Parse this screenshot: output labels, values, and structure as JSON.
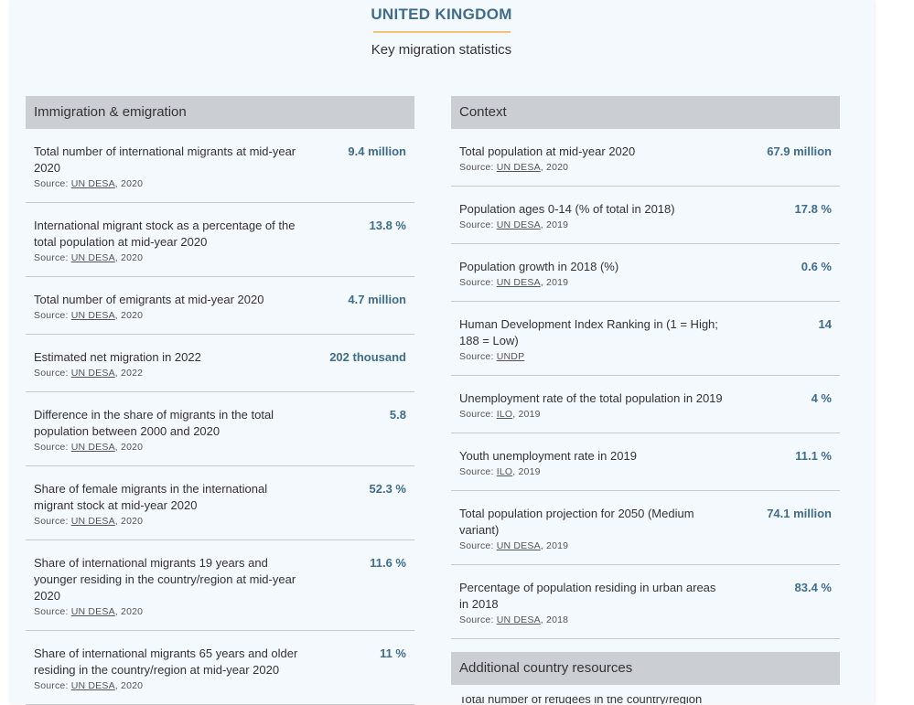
{
  "header": {
    "country": "UNITED KINGDOM",
    "subtitle": "Key migration statistics"
  },
  "immigration": {
    "title": "Immigration & emigration",
    "rows": [
      {
        "label": "Total number of international migrants at mid-year 2020",
        "value": "9.4 million",
        "source_prefix": "Source:",
        "source_link": "UN DESA",
        "source_year": ", 2020"
      },
      {
        "label": "International migrant stock as a percentage of the total population at mid-year 2020",
        "value": "13.8 %",
        "source_prefix": "Source:",
        "source_link": "UN DESA",
        "source_year": ", 2020"
      },
      {
        "label": "Total number of emigrants at mid-year 2020",
        "value": "4.7 million",
        "source_prefix": "Source:",
        "source_link": "UN DESA",
        "source_year": ", 2020"
      },
      {
        "label": "Estimated net migration in 2022",
        "value": "202 thousand",
        "source_prefix": "Source:",
        "source_link": "UN DESA",
        "source_year": ", 2022"
      },
      {
        "label": "Difference in the share of migrants in the total population between 2000 and 2020",
        "value": "5.8",
        "source_prefix": "Source:",
        "source_link": "UN DESA",
        "source_year": ", 2020"
      },
      {
        "label": "Share of female migrants in the international migrant stock at mid-year 2020",
        "value": "52.3 %",
        "source_prefix": "Source:",
        "source_link": "UN DESA",
        "source_year": ", 2020"
      },
      {
        "label": "Share of international migrants 19 years and younger residing in the country/region at mid-year 2020",
        "value": "11.6 %",
        "source_prefix": "Source:",
        "source_link": "UN DESA",
        "source_year": ", 2020"
      },
      {
        "label": "Share of international migrants 65 years and older residing in the country/region at mid-year 2020",
        "value": "11 %",
        "source_prefix": "Source:",
        "source_link": "UN DESA",
        "source_year": ", 2020"
      }
    ]
  },
  "context": {
    "title": "Context",
    "rows": [
      {
        "label": "Total population at mid-year 2020",
        "value": "67.9 million",
        "source_prefix": "Source:",
        "source_link": "UN DESA",
        "source_year": ", 2020"
      },
      {
        "label": "Population ages 0-14 (% of total in 2018)",
        "value": "17.8 %",
        "source_prefix": "Source:",
        "source_link": "UN DESA",
        "source_year": ", 2019"
      },
      {
        "label": "Population growth in 2018 (%)",
        "value": "0.6 %",
        "source_prefix": "Source:",
        "source_link": "UN DESA",
        "source_year": ", 2019"
      },
      {
        "label": "Human Development Index Ranking in (1 = High; 188 = Low)",
        "value": "14",
        "source_prefix": "Source:",
        "source_link": "UNDP",
        "source_year": ""
      },
      {
        "label": "Unemployment rate of the total population in 2019",
        "value": "4 %",
        "source_prefix": "Source:",
        "source_link": "ILO",
        "source_year": ", 2019"
      },
      {
        "label": "Youth unemployment rate in 2019",
        "value": "11.1 %",
        "source_prefix": "Source:",
        "source_link": "ILO",
        "source_year": ", 2019"
      },
      {
        "label": "Total population projection for 2050 (Medium variant)",
        "value": "74.1 million",
        "source_prefix": "Source:",
        "source_link": "UN DESA",
        "source_year": ", 2019"
      },
      {
        "label": "Percentage of population residing in urban areas in 2018",
        "value": "83.4 %",
        "source_prefix": "Source:",
        "source_link": "UN DESA",
        "source_year": ", 2018"
      }
    ]
  },
  "resources": {
    "title": "Additional country resources",
    "first_item": "Total number of refugees in the country/region"
  }
}
